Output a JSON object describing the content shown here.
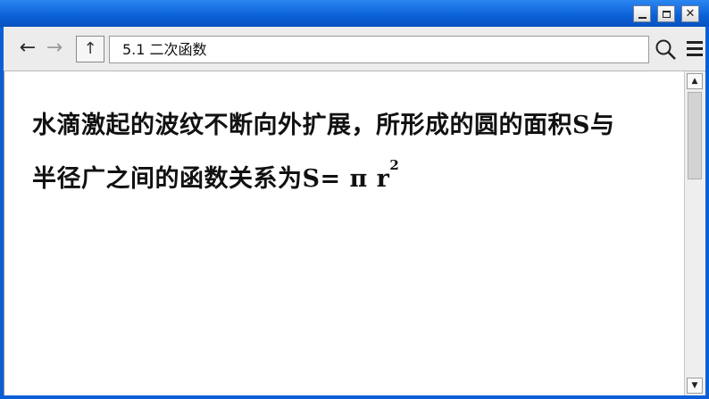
{
  "window": {
    "controls": {
      "minimize": "minimize",
      "maximize": "maximize",
      "close": "✕"
    }
  },
  "toolbar": {
    "back": "←",
    "forward": "→",
    "up": "↑",
    "address": "5.1 二次函数"
  },
  "content": {
    "line1": "水滴激起的波纹不断向外扩展，所形成的圆的面积S与",
    "line2_text": "半径广之间的函数关系为S= π r",
    "line2_sup": "2"
  },
  "scrollbar": {
    "up": "▲",
    "down": "▼"
  },
  "icons": {
    "search": "search-icon",
    "menu": "menu-icon"
  },
  "colors": {
    "titlebar": "#0a5fd8",
    "content_bg": "#ffffff",
    "toolbar_bg": "#ececec"
  }
}
